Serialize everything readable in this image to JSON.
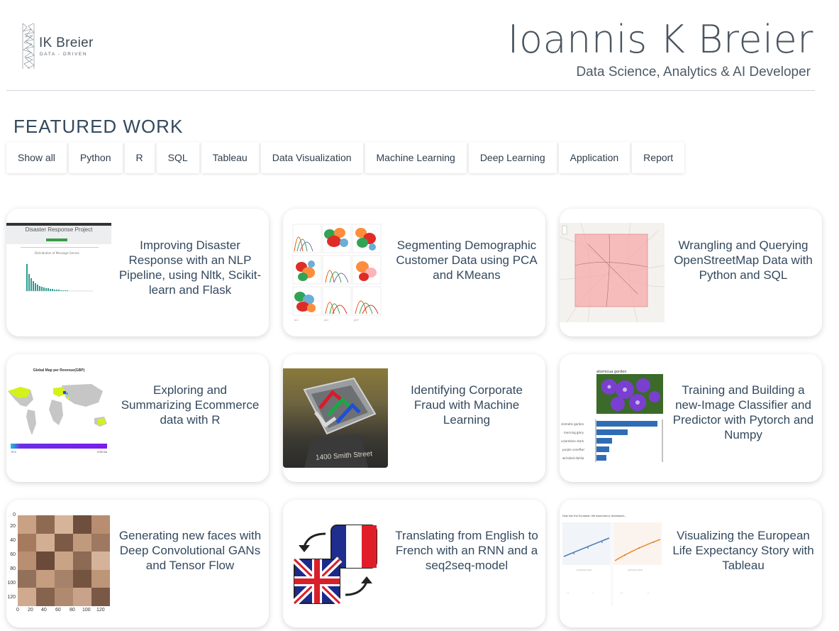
{
  "brand": {
    "logo_text": "IK Breier",
    "logo_sub": "DATA - DRIVEN",
    "title": "Ioannis K Breier",
    "subtitle": "Data Science, Analytics & AI Developer"
  },
  "featured": {
    "heading": "FEATURED WORK",
    "filters": [
      "Show all",
      "Python",
      "R",
      "SQL",
      "Tableau",
      "Data Visualization",
      "Machine Learning",
      "Deep Learning",
      "Application",
      "Report"
    ]
  },
  "projects": [
    {
      "title": "Improving Disaster Response with an NLP Pipeline, using Nltk, Scikit-learn and Flask",
      "thumb": "disaster-response-dashboard",
      "thumb_header": "Disaster Response Project"
    },
    {
      "title": "Segmenting Demographic Customer Data using PCA and KMeans",
      "thumb": "cluster-scatter-matrix"
    },
    {
      "title": "Wrangling and Querying OpenStreetMap Data with Python and SQL",
      "thumb": "osm-map"
    },
    {
      "title": "Exploring and Summarizing Ecommerce data with R",
      "thumb": "world-revenue-map",
      "thumb_header": "Global Map per Revenue(GBP)"
    },
    {
      "title": "Identifying Corporate Fraud with Machine Learning",
      "thumb": "enron-sign-photo",
      "thumb_caption": "1400 Smith Street"
    },
    {
      "title": "Training and Building a new-Image Classifier and Predictor with Pytorch and Numpy",
      "thumb": "flower-classifier"
    },
    {
      "title": "Generating new faces with Deep Convolutional GANs and Tensor Flow",
      "thumb": "face-grid",
      "axis_y": [
        "0",
        "20",
        "40",
        "60",
        "80",
        "100",
        "120"
      ],
      "axis_x": [
        "0",
        "20",
        "40",
        "60",
        "80",
        "100",
        "120"
      ]
    },
    {
      "title": "Translating from English to French with an RNN and a seq2seq-model",
      "thumb": "flags-translation"
    },
    {
      "title": "Visualizing the European Life Expectancy Story with Tableau",
      "thumb": "tableau-story"
    }
  ],
  "colors": {
    "text": "#34495e",
    "card_shadow": "rgba(0,0,0,0.16)",
    "divider": "#d0d5da"
  }
}
